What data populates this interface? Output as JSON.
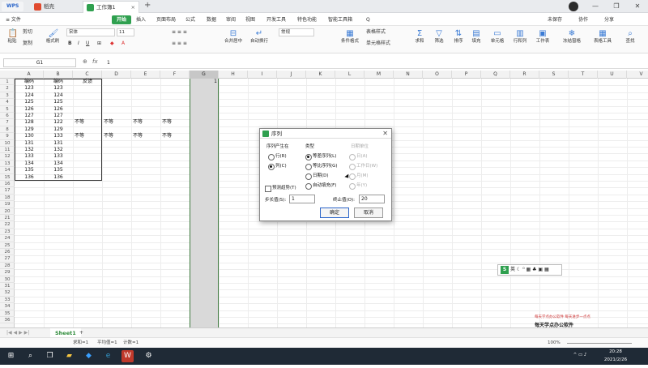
{
  "tabs": {
    "home": "WPS",
    "doc1": "稻壳",
    "doc2": "工作簿1",
    "new": "+"
  },
  "window": {
    "minimize": "—",
    "maximize": "❐",
    "close": "✕"
  },
  "menu": {
    "file": "≡ 文件",
    "items": [
      "开始",
      "插入",
      "页面布局",
      "公式",
      "数据",
      "审阅",
      "视图",
      "开发工具",
      "特色功能",
      "智能工具箱"
    ],
    "search": "Q",
    "unsaved": "未保存",
    "collab": "协作",
    "share": "分享"
  },
  "ribbon": {
    "cut": "剪切",
    "copy": "复制",
    "format_painter": "格式刷",
    "paste": "粘贴",
    "font": "宋体",
    "size": "11",
    "number_format": "常规",
    "merge": "合并居中",
    "wrap": "自动换行",
    "cond_format": "条件格式",
    "table_style": "表格样式",
    "cell_style": "单元格样式",
    "sum": "求和",
    "filter": "筛选",
    "sort": "排序",
    "fill": "填充",
    "cell": "单元格",
    "row_col": "行和列",
    "sheet": "工作表",
    "freeze": "冻结窗格",
    "table_tools": "表格工具",
    "find": "查找"
  },
  "formula_bar": {
    "name_box": "G1",
    "fx": "fx",
    "value": "1"
  },
  "grid": {
    "columns": [
      "A",
      "B",
      "C",
      "D",
      "E",
      "F",
      "G",
      "H",
      "I",
      "J",
      "K",
      "L",
      "M",
      "N",
      "O",
      "P",
      "Q",
      "R",
      "S",
      "T",
      "U",
      "V"
    ],
    "rows": [
      "1",
      "2",
      "3",
      "4",
      "5",
      "6",
      "7",
      "8",
      "9",
      "10",
      "11",
      "12",
      "13",
      "14",
      "15",
      "16",
      "17",
      "18",
      "19",
      "20",
      "21",
      "22",
      "23",
      "24",
      "25",
      "26",
      "27",
      "28",
      "29",
      "30",
      "31",
      "32",
      "33",
      "34",
      "35",
      "36"
    ],
    "header": [
      "编码",
      "编码",
      "反馈"
    ],
    "colA": [
      "123",
      "124",
      "125",
      "126",
      "127",
      "128",
      "129",
      "130",
      "131",
      "132",
      "133",
      "134",
      "135",
      "136"
    ],
    "colB": [
      "123",
      "124",
      "125",
      "126",
      "127",
      "122",
      "129",
      "133",
      "131",
      "132",
      "133",
      "134",
      "135",
      "136"
    ],
    "mismatch_label": "不等",
    "g1_value": "1"
  },
  "dialog": {
    "title": "序列",
    "group_series_in": "序列产生在",
    "rows": "行(R)",
    "cols": "列(C)",
    "group_type": "类型",
    "linear": "等差序列(L)",
    "growth": "等比序列(G)",
    "date": "日期(D)",
    "autofill": "自动填充(F)",
    "group_date_unit": "日期单位",
    "day": "日(A)",
    "weekday": "工作日(W)",
    "month": "月(M)",
    "year": "年(Y)",
    "predict": "预测趋势(T)",
    "step_label": "步长值(S):",
    "step_value": "1",
    "stop_label": "终止值(O):",
    "stop_value": "20",
    "ok": "确定",
    "cancel": "取消"
  },
  "ime": {
    "s": "S",
    "text": "英 ☾ ⁰ ▦ ♣ ▣ ▦"
  },
  "watermark": {
    "line1": "每天学点办公软件    每天进步一点点",
    "line2": "每天学点办公软件"
  },
  "sheets": {
    "active": "Sheet1",
    "add": "+"
  },
  "status": {
    "sum": "求和=1",
    "avg": "平均值=1",
    "count": "计数=1",
    "zoom": "100%"
  },
  "taskbar": {
    "time": "20:28",
    "date": "2021/2/26"
  }
}
